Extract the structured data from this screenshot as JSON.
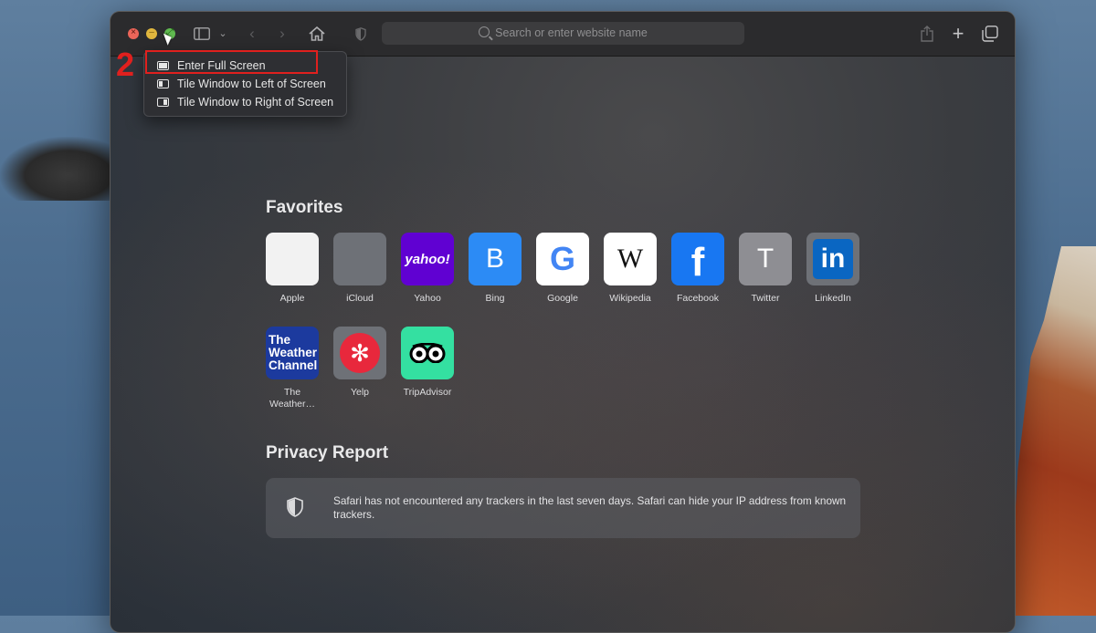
{
  "toolbar": {
    "search_placeholder": "Search or enter website name"
  },
  "annotation": {
    "step_number": "2",
    "highlight_color": "#e0201e"
  },
  "window_menu": {
    "items": [
      {
        "label": "Enter Full Screen",
        "icon": "full-screen-icon"
      },
      {
        "label": "Tile Window to Left of Screen",
        "icon": "tile-left-icon"
      },
      {
        "label": "Tile Window to Right of Screen",
        "icon": "tile-right-icon"
      }
    ]
  },
  "favorites": {
    "title": "Favorites",
    "items": [
      {
        "label": "Apple",
        "glyph": "",
        "bg": "#f2f2f2"
      },
      {
        "label": "iCloud",
        "glyph": "",
        "bg": "#6e7177"
      },
      {
        "label": "Yahoo",
        "glyph": "yahoo!",
        "bg": "#6001d2"
      },
      {
        "label": "Bing",
        "glyph": "B",
        "bg": "#2c8bf5"
      },
      {
        "label": "Google",
        "glyph": "G",
        "bg": "#ffffff"
      },
      {
        "label": "Wikipedia",
        "glyph": "W",
        "bg": "#ffffff"
      },
      {
        "label": "Facebook",
        "glyph": "f",
        "bg": "#1877f2"
      },
      {
        "label": "Twitter",
        "glyph": "T",
        "bg": "#8e8e93"
      },
      {
        "label": "LinkedIn",
        "glyph": "in",
        "bg": "#6e7177"
      },
      {
        "label": "The Weather…",
        "glyph": "The Weather Channel",
        "bg": "#1c3a9e"
      },
      {
        "label": "Yelp",
        "glyph": "yelp",
        "bg": "#6e7177"
      },
      {
        "label": "TripAdvisor",
        "glyph": "oo",
        "bg": "#34e0a1"
      }
    ]
  },
  "privacy": {
    "title": "Privacy Report",
    "message": "Safari has not encountered any trackers in the last seven days. Safari can hide your IP address from known trackers."
  }
}
